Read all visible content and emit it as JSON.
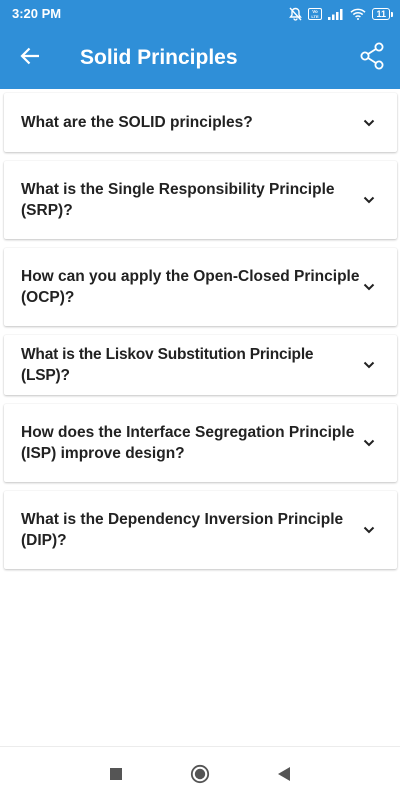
{
  "status_bar": {
    "time": "3:20 PM",
    "battery": "11",
    "network_label": "Vo LTE"
  },
  "app_bar": {
    "title": "Solid Principles"
  },
  "questions": [
    {
      "text": "What are the SOLID principles?"
    },
    {
      "text": "What is the Single Responsibility Principle (SRP)?"
    },
    {
      "text": "How can you apply the Open-Closed Principle (OCP)?"
    },
    {
      "text": "What is the Liskov Substitution Principle (LSP)?"
    },
    {
      "text": "How does the Interface Segregation Principle (ISP) improve design?"
    },
    {
      "text": "What is the Dependency Inversion Principle (DIP)?"
    }
  ],
  "colors": {
    "primary": "#2f8fd8",
    "card_text": "#222222"
  },
  "icons": {
    "back": "arrow-left-icon",
    "share": "share-icon",
    "expand": "chevron-down-icon",
    "nav_recents": "square-icon",
    "nav_home": "circle-icon",
    "nav_back": "triangle-back-icon"
  }
}
